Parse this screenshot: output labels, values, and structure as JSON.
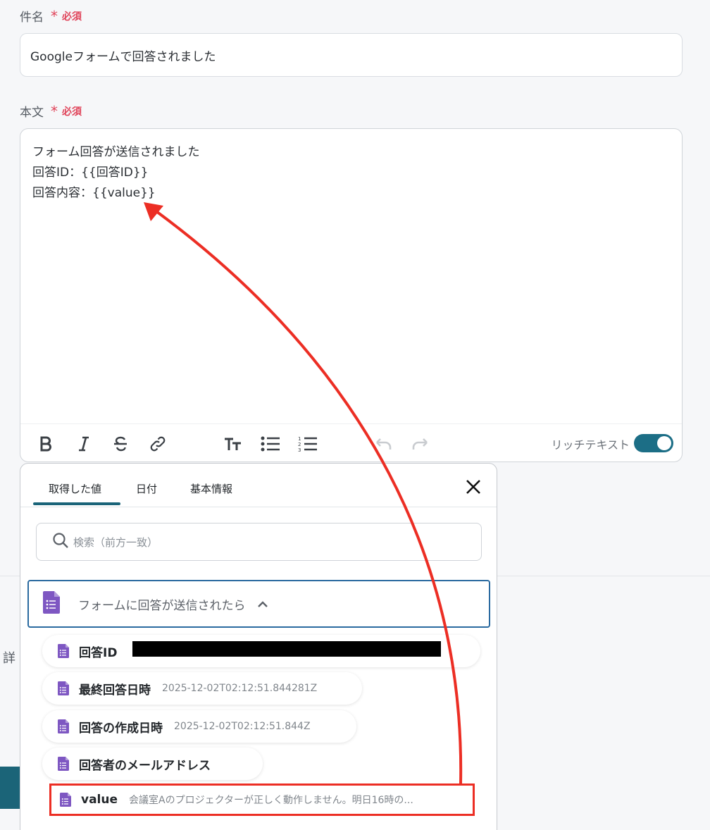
{
  "subject": {
    "label": "件名",
    "required_star": "*",
    "required_text": "必須",
    "value": "Googleフォームで回答されました"
  },
  "body": {
    "label": "本文",
    "required_star": "*",
    "required_text": "必須",
    "lines": [
      "フォーム回答が送信されました",
      "回答ID：{{回答ID}}",
      "回答内容：{{value}}"
    ],
    "rich_text_label": "リッチテキスト",
    "rich_text_enabled": true
  },
  "side": {
    "partial_label": "詳"
  },
  "picker": {
    "tabs": [
      "取得した値",
      "日付",
      "基本情報"
    ],
    "active_tab": 0,
    "search_placeholder": "検索（前方一致）",
    "group_title": "フォームに回答が送信されたら",
    "items": [
      {
        "name": "回答ID",
        "value": "…"
      },
      {
        "name": "最終回答日時",
        "value": "2025-12-02T02:12:51.844281Z"
      },
      {
        "name": "回答の作成日時",
        "value": "2025-12-02T02:12:51.844Z"
      },
      {
        "name": "回答者のメールアドレス",
        "value": ""
      },
      {
        "name": "value",
        "value": "会議室Aのプロジェクターが正しく動作しません。明日16時の..."
      }
    ]
  },
  "colors": {
    "accent": "#1a6479",
    "required": "#e0445a",
    "forms_purple": "#7e57c2",
    "annotation_red": "#ec2e24"
  }
}
